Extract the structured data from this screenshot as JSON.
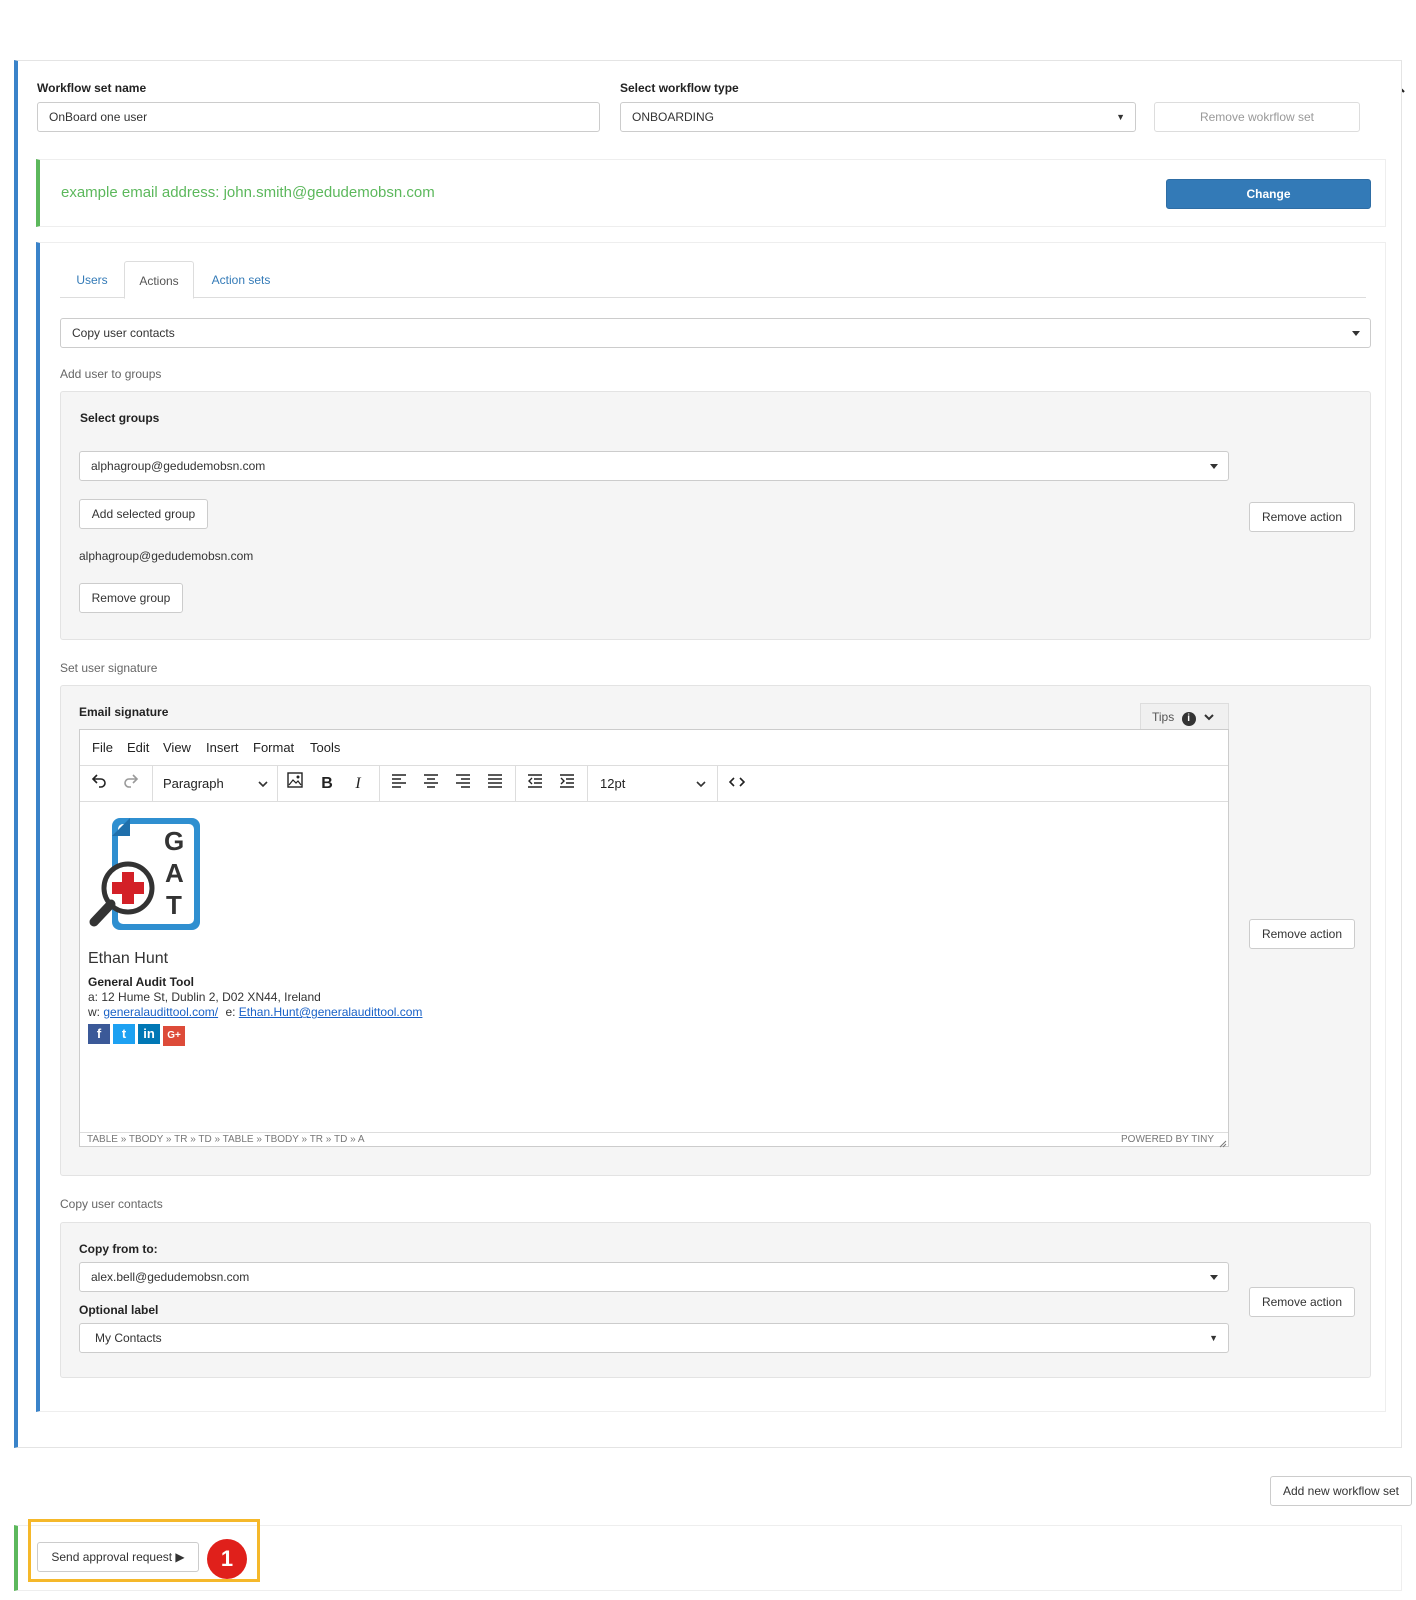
{
  "workflow": {
    "name_label": "Workflow set name",
    "name_value": "OnBoard one user",
    "type_label": "Select workflow type",
    "type_value": "ONBOARDING",
    "remove_label": "Remove wokrflow set"
  },
  "email_example": {
    "text": "example email address: john.smith@gedudemobsn.com",
    "change_label": "Change",
    "text_color": "#5cb85c"
  },
  "tabs": [
    {
      "label": "Users"
    },
    {
      "label": "Actions"
    },
    {
      "label": "Action sets"
    }
  ],
  "action_select": {
    "value": "Copy user contacts"
  },
  "add_groups": {
    "section_title": "Add user to groups",
    "select_label": "Select groups",
    "select_value": "alphagroup@gedudemobsn.com",
    "add_button": "Add selected group",
    "selected_group": "alphagroup@gedudemobsn.com",
    "remove_group_button": "Remove group",
    "remove_action": "Remove action"
  },
  "signature": {
    "section_title": "Set user signature",
    "label": "Email signature",
    "tips": "Tips",
    "menu": [
      "File",
      "Edit",
      "View",
      "Insert",
      "Format",
      "Tools"
    ],
    "block_format": "Paragraph",
    "font_size": "12pt",
    "logo_letters": [
      "G",
      "A",
      "T"
    ],
    "name": "Ethan Hunt",
    "company": "General Audit Tool",
    "address_prefix": "a:",
    "address": "12 Hume St, Dublin 2, D02 XN44, Ireland",
    "web_prefix": "w:",
    "web": "generalaudittool.com/",
    "email_prefix": "e:",
    "email": "Ethan.Hunt@generalaudittool.com",
    "social": [
      "f",
      "t",
      "in",
      "G+"
    ],
    "statusbar_path": "TABLE » TBODY » TR » TD » TABLE » TBODY » TR » TD » A",
    "powered_by": "POWERED BY TINY",
    "remove_action": "Remove action"
  },
  "copy_contacts": {
    "section_title": "Copy user contacts",
    "copy_label": "Copy from to:",
    "copy_value": "alex.bell@gedudemobsn.com",
    "optional_label": "Optional label",
    "optional_value": "My Contacts",
    "remove_action": "Remove action"
  },
  "add_new_workflow": "Add new workflow set",
  "send_approval": "Send approval request ▶",
  "step_badge": "1",
  "colors": {
    "accent_blue": "#3a83c9",
    "primary_button": "#337ab7",
    "green_accent": "#5cb85c",
    "highlight": "#f5b82a",
    "badge": "#e0201b"
  }
}
